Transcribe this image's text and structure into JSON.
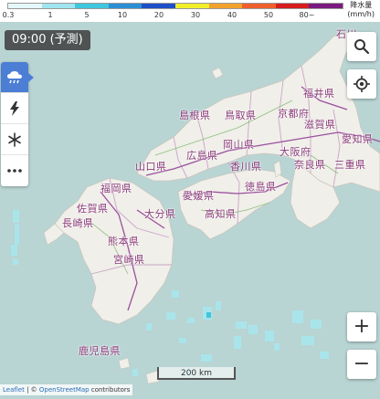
{
  "legend": {
    "title": "降水量",
    "unit": "(mm/h)",
    "colors": [
      "#e5f8fb",
      "#9fe5ef",
      "#3ec6dd",
      "#2a8fd4",
      "#1c4fc8",
      "#f2ee2a",
      "#f2a22a",
      "#ee5f2c",
      "#d61c1c",
      "#7b1a7e"
    ],
    "labels": [
      "0.3",
      "1",
      "5",
      "10",
      "20",
      "30",
      "40",
      "50",
      "80~"
    ]
  },
  "time_badge": "09:00 (予測)",
  "layers": [
    {
      "name": "rain",
      "icon": "rain-cloud-icon",
      "active": true
    },
    {
      "name": "lightning",
      "icon": "lightning-icon",
      "active": false
    },
    {
      "name": "snow",
      "icon": "snowflake-icon",
      "active": false
    },
    {
      "name": "more",
      "icon": "more-icon",
      "active": false
    }
  ],
  "controls": {
    "zoom_in": "+",
    "zoom_out": "−"
  },
  "scale_bar": "200 km",
  "attribution": {
    "leaflet": "Leaflet",
    "sep": " | © ",
    "osm": "OpenStreetMap",
    "contrib": " contributors"
  },
  "prefectures": {
    "ishikawa": "石川",
    "fukui": "福井県",
    "kyoto": "京都府",
    "shiga": "滋賀県",
    "aichi": "愛知県",
    "osaka": "大阪府",
    "nara": "奈良県",
    "mie": "三重県",
    "shimane": "島根県",
    "tottori": "鳥取県",
    "okayama": "岡山県",
    "hiroshima": "広島県",
    "yamaguchi": "山口県",
    "kagawa": "香川県",
    "tokushima": "徳島県",
    "ehime": "愛媛県",
    "kochi": "高知県",
    "fukuoka": "福岡県",
    "saga": "佐賀県",
    "nagasaki": "長崎県",
    "oita": "大分県",
    "kumamoto": "熊本県",
    "miyazaki": "宮崎県",
    "kagoshima": "鹿児島県"
  }
}
